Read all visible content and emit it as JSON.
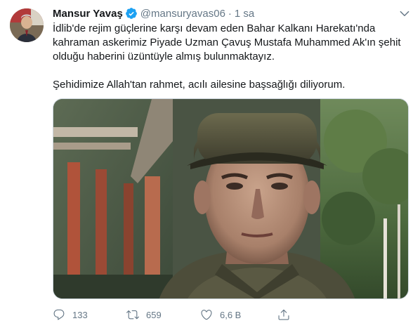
{
  "tweet": {
    "author": {
      "display_name": "Mansur Yavaş",
      "handle": "@mansuryavas06",
      "verified": true
    },
    "separator": "·",
    "time": "1 sa",
    "text_paragraphs": [
      "İdlib'de rejim güçlerine karşı devam eden Bahar Kalkanı Harekatı'nda kahraman askerimiz Piyade Uzman Çavuş Mustafa Muhammed Ak'ın şehit olduğu haberini üzüntüyle almış bulunmaktayız.",
      "Şehidimize Allah'tan rahmet, acılı ailesine başsağlığı diliyorum."
    ],
    "actions": {
      "replies": "133",
      "retweets": "659",
      "likes": "6,6 B"
    }
  },
  "icons": {
    "verified": "verified-badge-icon",
    "caret": "chevron-down-icon",
    "reply": "reply-icon",
    "retweet": "retweet-icon",
    "like": "heart-icon",
    "share": "share-icon"
  },
  "colors": {
    "text_primary": "#14171a",
    "text_secondary": "#657786",
    "verified_blue": "#1da1f2",
    "border": "#ccd6dd"
  }
}
